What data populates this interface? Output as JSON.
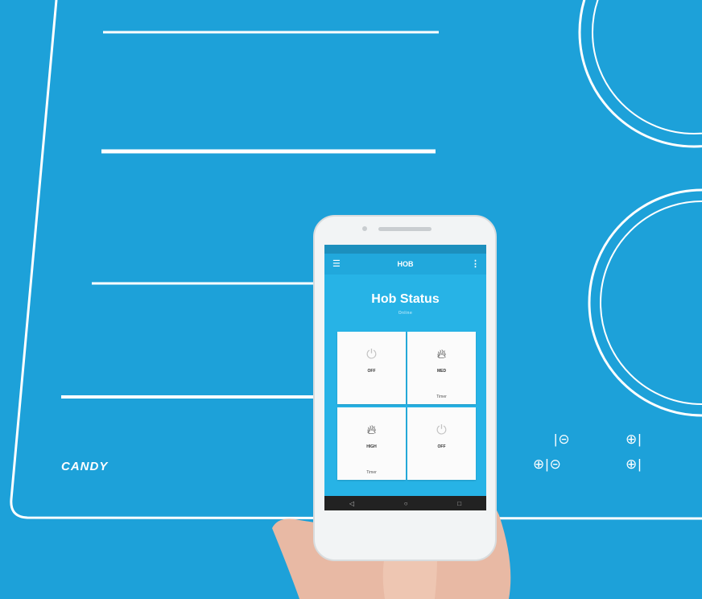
{
  "brand": {
    "logo_text": "CANDY"
  },
  "phone": {
    "app_title": "HOB",
    "status_title": "Hob Status",
    "status_subtitle": "Online",
    "tiles": [
      {
        "label": "OFF",
        "icon": "power-icon",
        "state": "off",
        "sub": ""
      },
      {
        "label": "MED",
        "icon": "flame-icon",
        "state": "on",
        "sub": "Timer"
      },
      {
        "label": "HIGH",
        "icon": "flame-icon",
        "state": "on",
        "sub": "Timer"
      },
      {
        "label": "OFF",
        "icon": "power-icon",
        "state": "off",
        "sub": ""
      }
    ],
    "nav": {
      "back": "◁",
      "home": "○",
      "recent": "□"
    }
  },
  "hob_controls": {
    "row1_left": "|⊝",
    "row1_right": "⊕|",
    "row2_left": "⊕|⊝",
    "row2_right": "⊕|"
  },
  "colors": {
    "hob_blue": "#1da1d9",
    "line_white": "#ffffff",
    "skin": "#e8b9a4"
  }
}
